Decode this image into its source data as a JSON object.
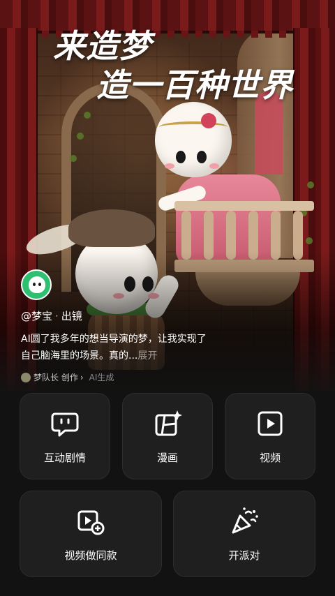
{
  "hero": {
    "headline_line1": "来造梦",
    "headline_line2": "造一百种世界"
  },
  "post": {
    "author": "@梦宝",
    "role": "出镜",
    "separator": "·",
    "description": "AI圆了我多年的想当导演的梦，让我实现了自己脑海里的场景。真的...",
    "expand_label": "展开",
    "creator": "梦队长 创作",
    "creator_chevron": "›",
    "ai_tag": "AI生成"
  },
  "features": [
    {
      "label": "互动剧情",
      "icon": "chat-bubble-icon"
    },
    {
      "label": "漫画",
      "icon": "comic-sparkle-icon"
    },
    {
      "label": "视频",
      "icon": "play-box-icon"
    },
    {
      "label": "视频做同款",
      "icon": "video-add-icon"
    },
    {
      "label": "开派对",
      "icon": "party-popper-icon"
    }
  ],
  "colors": {
    "background": "#121212",
    "card": "#1f1f1f",
    "avatar_green": "#2fbf71"
  }
}
